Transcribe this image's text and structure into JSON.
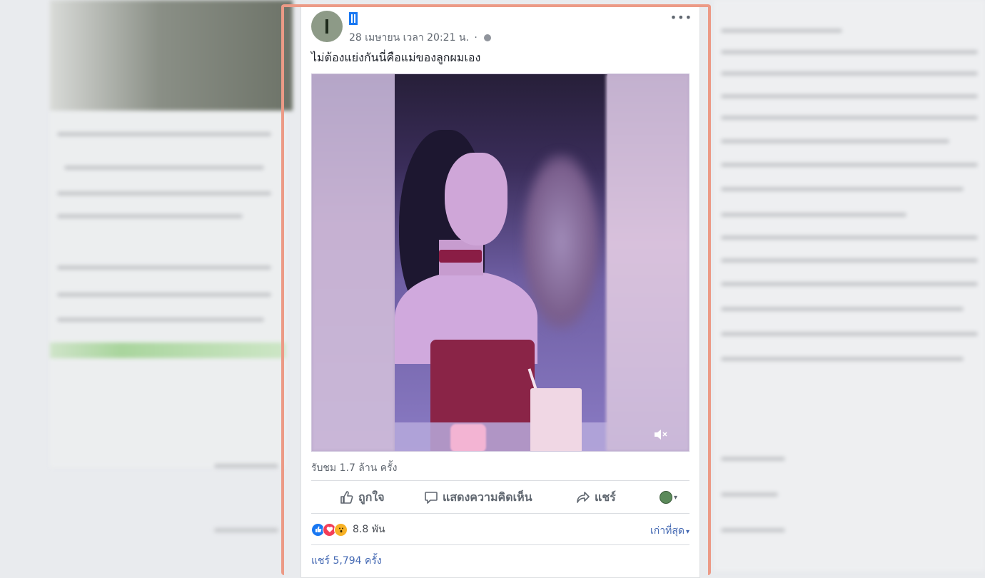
{
  "post": {
    "author_avatar_letter": "I",
    "timestamp": "28 เมษายน เวลา 20:21 น.",
    "meta_separator": "·",
    "caption": "ไม่ต้องแย่งกันนี่คือแม่ของลูกผมเอง",
    "views": "รับชม 1.7 ล้าน ครั้ง",
    "more_icon": "•••"
  },
  "actions": {
    "like": "ถูกใจ",
    "comment": "แสดงความคิดเห็น",
    "share": "แชร์",
    "like_icon": "thumbs-up-icon",
    "comment_icon": "speech-bubble-icon",
    "share_icon": "share-arrow-icon"
  },
  "reactions": {
    "count": "8.8 พัน",
    "types": [
      "like",
      "love",
      "wow"
    ]
  },
  "sort": {
    "label": "เก่าที่สุด",
    "caret": "▾"
  },
  "shares": "แชร์ 5,794 ครั้ง",
  "colors": {
    "accent": "#4267b2",
    "highlight_border": "#ec9a86",
    "like_reaction": "#1877f2",
    "love_reaction": "#f33e58",
    "wow_reaction": "#f7b125"
  }
}
